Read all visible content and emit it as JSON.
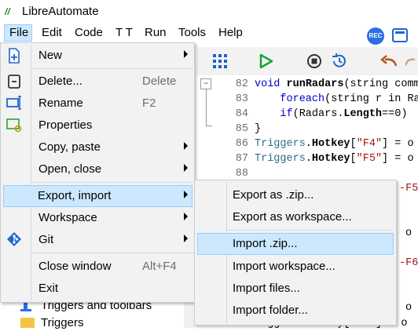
{
  "app": {
    "title": "LibreAutomate",
    "logo_text": "//"
  },
  "menubar": {
    "items": [
      "File",
      "Edit",
      "Code",
      "T T",
      "Run",
      "Tools",
      "Help"
    ],
    "rec_label": "REC"
  },
  "editor": {
    "lines": [
      {
        "n": "82",
        "parts": [
          [
            "kw",
            "void "
          ],
          [
            "fn",
            "runRadars"
          ],
          [
            "",
            "(string comm"
          ]
        ]
      },
      {
        "n": "83",
        "parts": [
          [
            "",
            "    "
          ],
          [
            "kw",
            "foreach"
          ],
          [
            "",
            "(string r in Ra"
          ]
        ]
      },
      {
        "n": "84",
        "parts": [
          [
            "",
            "    "
          ],
          [
            "kw",
            "if"
          ],
          [
            "",
            "(Radars."
          ],
          [
            "fn",
            "Length"
          ],
          [
            "",
            "==0)"
          ]
        ]
      },
      {
        "n": "85",
        "parts": [
          [
            "",
            "}"
          ]
        ]
      },
      {
        "n": "86",
        "parts": [
          [
            "cls",
            "Triggers"
          ],
          [
            "",
            "."
          ],
          [
            "fn",
            "Hotkey"
          ],
          [
            "",
            "["
          ],
          [
            "str",
            "\"F4\""
          ],
          [
            "",
            "] = o"
          ]
        ]
      },
      {
        "n": "87",
        "parts": [
          [
            "cls",
            "Triggers"
          ],
          [
            "",
            "."
          ],
          [
            "fn",
            "Hotkey"
          ],
          [
            "",
            "["
          ],
          [
            "str",
            "\"F5\""
          ],
          [
            "",
            "] = o"
          ]
        ]
      },
      {
        "n": "88",
        "parts": [
          [
            "",
            ""
          ]
        ]
      }
    ],
    "fragments": {
      "f5": "-F5\"",
      "o1": "o",
      "f6": "-F6\"",
      "o2": "o",
      "last": "riggers.Hotkey[ F6 ] = o"
    }
  },
  "file_menu": {
    "items": [
      {
        "label": "New",
        "shortcut": "",
        "submenu": true
      },
      {
        "label": "Delete...",
        "shortcut": "Delete",
        "submenu": false
      },
      {
        "label": "Rename",
        "shortcut": "F2",
        "submenu": false
      },
      {
        "label": "Properties",
        "shortcut": "",
        "submenu": false
      },
      {
        "label": "Copy, paste",
        "shortcut": "",
        "submenu": true
      },
      {
        "label": "Open, close",
        "shortcut": "",
        "submenu": true
      },
      {
        "label": "Export, import",
        "shortcut": "",
        "submenu": true
      },
      {
        "label": "Workspace",
        "shortcut": "",
        "submenu": true
      },
      {
        "label": "Git",
        "shortcut": "",
        "submenu": true
      },
      {
        "label": "Close window",
        "shortcut": "Alt+F4",
        "submenu": false
      },
      {
        "label": "Exit",
        "shortcut": "",
        "submenu": false
      }
    ]
  },
  "export_import_menu": {
    "items": [
      "Export as .zip...",
      "Export as workspace...",
      "Import .zip...",
      "Import workspace...",
      "Import files...",
      "Import folder..."
    ]
  },
  "tree": {
    "items": [
      "Triggers and toolbars",
      "Triggers"
    ]
  },
  "colors": {
    "highlight": "#cce8ff",
    "highlight_border": "#99ccff",
    "accent": "#2d6ee6"
  }
}
